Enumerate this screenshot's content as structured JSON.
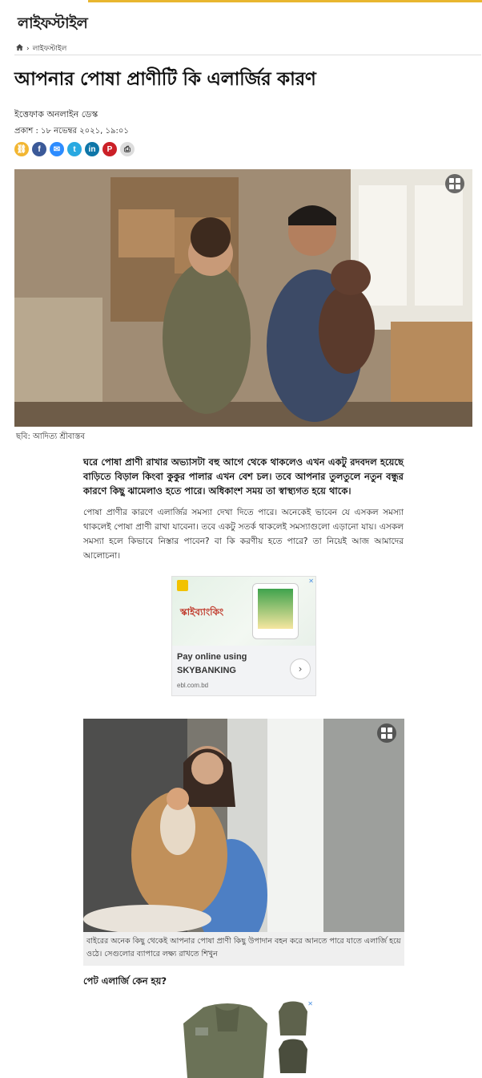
{
  "section": {
    "title": "লাইফস্টাইল"
  },
  "breadcrumb": {
    "home_icon": "home-icon",
    "separator": "›",
    "current": "লাইফস্টাইল"
  },
  "article": {
    "headline": "আপনার পোষা প্রাণীটি কি এলার্জির কারণ",
    "author": "ইত্তেফাক অনলাইন ডেস্ক",
    "published": "প্রকাশ : ১৮ নভেম্বর ২০২১, ১৯:০১",
    "image1_caption": "ছবি: আদিত্য শ্রীবাস্তব",
    "lead": "ঘরে পোষা প্রাণী রাখার অভ্যাসটা বহু আগে থেকে থাকলেও এখন একটু রদবদল হয়েছে বাড়িতে বিড়াল কিংবা কুকুর পালার এখন বেশ চল। তবে আপনার তুলতুলে নতুন বন্ধুর কারণে কিছু ঝামেলাও হতে পারে। অধিকাংশ সময় তা স্বাস্থ্যগত হয়ে থাকে।",
    "paragraph1": "পোষা প্রাণীর কারণে এলার্জির সমস্যা দেখা দিতে পারে। অনেকেই ভাবেন যে এসকল সমস্যা থাকলেই পোষা প্রাণী রাখা যাবেনা। তবে একটু সতর্ক থাকলেই সমস্যাগুলো এড়ানো যায়। এসকল সমস্যা হলে কিভাবে নিস্তার পাবেন? বা কি করণীয় হতে পারে? তা নিয়েই আজ আমাদের আলোচনা।",
    "image2_caption": "বাইরের অনেক কিছু থেকেই আপনার পোষা প্রাণী কিছু উপাদান বহন করে আনতে পারে যাতে এলার্জি হয়ে ওঠে। সেগুলোর ব্যাপারে লক্ষ্য রাখতে শিখুন",
    "subheading1": "পেট এলার্জি কেন হয়?"
  },
  "share_icons": [
    {
      "name": "copy-link-icon",
      "glyph": "⛓",
      "color": "#f2b632"
    },
    {
      "name": "facebook-icon",
      "glyph": "f",
      "color": "#3b5998"
    },
    {
      "name": "messenger-icon",
      "glyph": "✉",
      "color": "#2d8cff"
    },
    {
      "name": "twitter-icon",
      "glyph": "t",
      "color": "#29a9e1"
    },
    {
      "name": "linkedin-icon",
      "glyph": "in",
      "color": "#0e76a8"
    },
    {
      "name": "pinterest-icon",
      "glyph": "P",
      "color": "#cb2027"
    },
    {
      "name": "print-icon",
      "glyph": "⎙",
      "color": "#dddddd"
    }
  ],
  "ad1": {
    "banner_text": "স্কাইব্যাংকিং",
    "cta_line1": "Pay online using",
    "cta_line2": "SKYBANKING",
    "domain": "ebl.com.bd",
    "close": "✕"
  },
  "ad2": {
    "close": "✕"
  }
}
